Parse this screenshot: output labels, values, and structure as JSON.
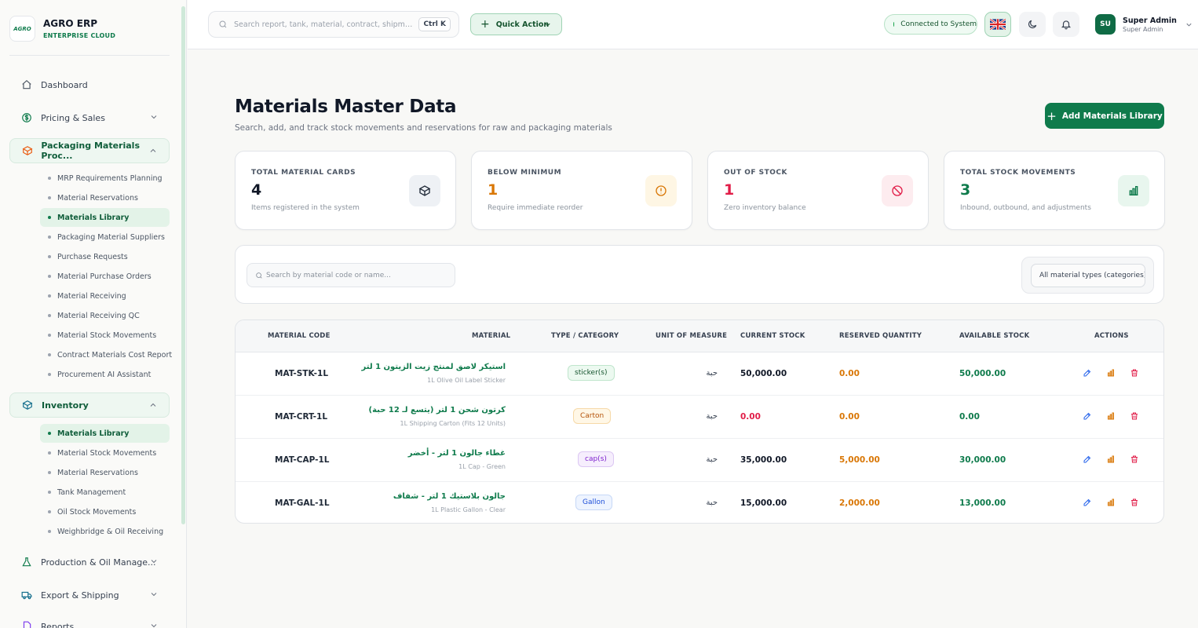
{
  "brand": {
    "logo_text": "AGRO",
    "name": "AGRO ERP",
    "subtitle": "ENTERPRISE CLOUD"
  },
  "sidebar": {
    "dashboard": "Dashboard",
    "pricing": "Pricing & Sales",
    "packaging": "Packaging Materials Proc...",
    "packaging_items": [
      "MRP Requirements Planning",
      "Material Reservations",
      "Materials Library",
      "Packaging Material Suppliers",
      "Purchase Requests",
      "Material Purchase Orders",
      "Material Receiving",
      "Material Receiving QC",
      "Material Stock Movements",
      "Contract Materials Cost Report",
      "Procurement AI Assistant"
    ],
    "inventory": "Inventory",
    "inventory_items": [
      "Materials Library",
      "Material Stock Movements",
      "Material Reservations",
      "Tank Management",
      "Oil Stock Movements",
      "Weighbridge & Oil Receiving"
    ],
    "production": "Production & Oil Manage...",
    "export": "Export & Shipping",
    "reports": "Reports"
  },
  "topbar": {
    "search_placeholder": "Search report, tank, material, contract, shipment, sup...",
    "shortcut": "Ctrl K",
    "quick_action": "Quick Action",
    "connection": "Connected to System",
    "user_initials": "SU",
    "user_name": "Super Admin",
    "user_role": "Super Admin"
  },
  "page": {
    "title": "Materials Master Data",
    "subtitle": "Search, add, and track stock movements and reservations for raw and packaging materials",
    "add_button": "Add Materials Library"
  },
  "stats": [
    {
      "label": "TOTAL MATERIAL CARDS",
      "value": "4",
      "desc": "Items registered in the system",
      "color": "#111827",
      "icon": "cube-icon"
    },
    {
      "label": "BELOW MINIMUM",
      "value": "1",
      "desc": "Require immediate reorder",
      "color": "#d97706",
      "icon": "alert-circle-icon"
    },
    {
      "label": "OUT OF STOCK",
      "value": "1",
      "desc": "Zero inventory balance",
      "color": "#e11d48",
      "icon": "ban-icon"
    },
    {
      "label": "TOTAL STOCK MOVEMENTS",
      "value": "3",
      "desc": "Inbound, outbound, and adjustments",
      "color": "#0f7b4c",
      "icon": "bar-chart-icon"
    }
  ],
  "filters": {
    "search_placeholder": "Search by material code or name...",
    "category_select": "All material types (categories)"
  },
  "table": {
    "headers": [
      "MATERIAL CODE",
      "MATERIAL",
      "TYPE / CATEGORY",
      "UNIT OF MEASURE",
      "CURRENT STOCK",
      "RESERVED QUANTITY",
      "AVAILABLE STOCK",
      "ACTIONS"
    ],
    "rows": [
      {
        "code": "MAT-STK-1L",
        "name_ar": "استيكر لاصق لمنتج زيت الزيتون 1 لتر",
        "name_en": "1L Olive Oil Label Sticker",
        "type": "sticker(s)",
        "unit": "حبة",
        "current": "50,000.00",
        "reserved": "0.00",
        "available": "50,000.00"
      },
      {
        "code": "MAT-CRT-1L",
        "name_ar": "كرتون شحن 1 لتر (يتسع لـ 12 حبة)",
        "name_en": "1L Shipping Carton (Fits 12 Units)",
        "type": "Carton",
        "unit": "حبة",
        "current": "0.00",
        "reserved": "0.00",
        "available": "0.00"
      },
      {
        "code": "MAT-CAP-1L",
        "name_ar": "غطاء جالون 1 لتر - أخضر",
        "name_en": "1L Cap - Green",
        "type": "cap(s)",
        "unit": "حبة",
        "current": "35,000.00",
        "reserved": "5,000.00",
        "available": "30,000.00"
      },
      {
        "code": "MAT-GAL-1L",
        "name_ar": "جالون بلاستيك 1 لتر - شفاف",
        "name_en": "1L Plastic Gallon - Clear",
        "type": "Gallon",
        "unit": "حبة",
        "current": "15,000.00",
        "reserved": "2,000.00",
        "available": "13,000.00"
      }
    ]
  },
  "colors": {
    "brand_green": "#0f7b4c",
    "warning": "#d97706",
    "danger": "#e11d48",
    "edit_blue": "#2563eb"
  }
}
